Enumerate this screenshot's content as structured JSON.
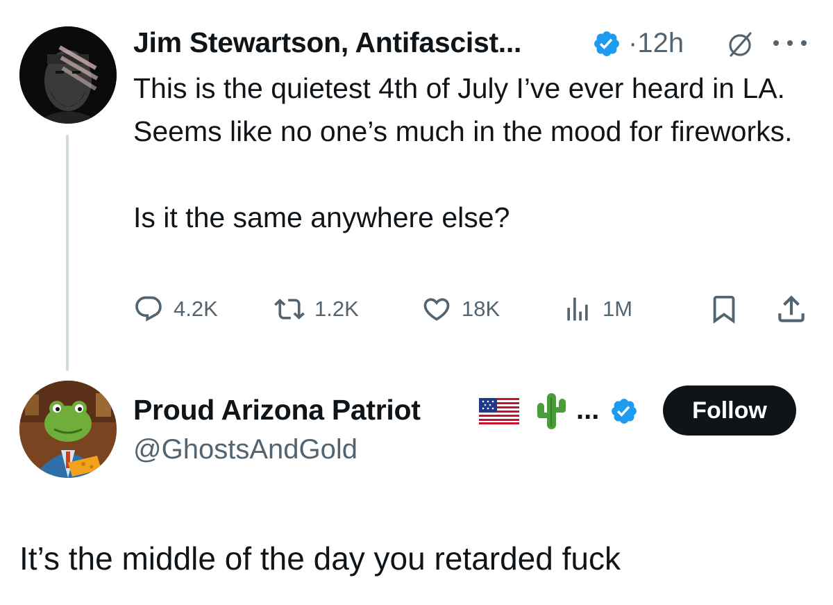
{
  "original_tweet": {
    "author_name": "Jim Stewartson, Antifascist...",
    "verified": true,
    "separator": "·",
    "time": "12h",
    "text": "This is the quietest 4th of July I’ve ever heard in LA. Seems like no one’s much in the mood for fireworks.\n\nIs it the same anywhere else?",
    "avatar_icon": "portrait-avatar",
    "actions": {
      "replies": "4.2K",
      "reposts": "1.2K",
      "likes": "18K",
      "views": "1M"
    }
  },
  "reply": {
    "author_name": "Proud Arizona Patriot",
    "name_suffix": "...",
    "name_emojis": [
      "us-flag-icon",
      "cactus-icon"
    ],
    "verified": true,
    "handle": "@GhostsAndGold",
    "follow_label": "Follow",
    "avatar_icon": "frog-cartoon-avatar",
    "text": "It’s the middle of the day you retarded fuck"
  },
  "colors": {
    "text_primary": "#0f1419",
    "text_secondary": "#536471",
    "verified_blue": "#1d9bf0",
    "thread_line": "#cfd9de",
    "follow_button_bg": "#0f1419"
  }
}
